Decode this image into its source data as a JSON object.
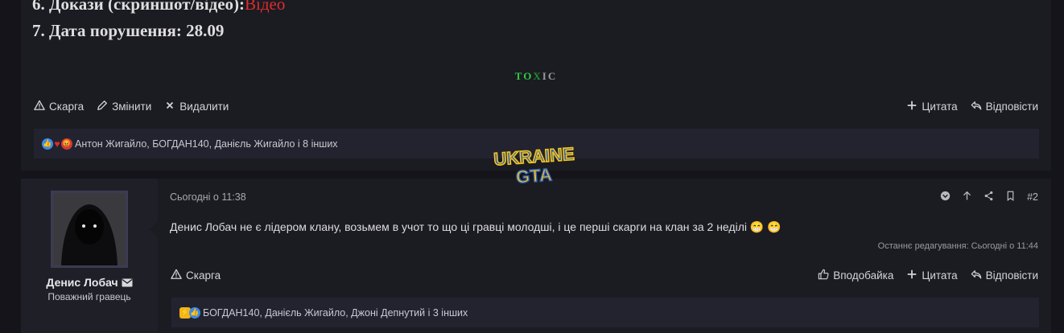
{
  "post1": {
    "line1_label": "6. Докази (скриншот/відео):",
    "line1_value": "Відео",
    "line2": "7. Дата порушення: 28.09",
    "signature": {
      "t": "T",
      "o": "O",
      "x": "X",
      "i": "I",
      "c": "C"
    },
    "actions": {
      "report": "Скарга",
      "edit": "Змінити",
      "delete": "Видалити",
      "quote": "Цитата",
      "reply": "Відповісти"
    },
    "reactions_text": "Антон Жигайло, БОГДАН140, Данієль Жигайло і 8 інших"
  },
  "watermark": {
    "line1": "UKRAINE",
    "line2": "GTA"
  },
  "post2": {
    "author": "Денис Лобач",
    "author_title": "Поважний гравець",
    "time": "Сьогодні о 11:38",
    "post_number": "#2",
    "message": "Денис Лобач не є лідером клану, возьмем в учот то що ці гравці молодші, і це перші скарги на клан за 2 неділі 😁 😁",
    "edited": "Останнє редагування: Сьогодні о 11:44",
    "actions": {
      "report": "Скарга",
      "like": "Вподобайка",
      "quote": "Цитата",
      "reply": "Відповісти"
    },
    "reactions_text": "БОГДАН140, Данієль Жигайло, Джоні Депнутий і 3 інших"
  },
  "colors": {
    "accent_red": "#e02c2c",
    "toxic_green": "#2ecc40",
    "toxic_grey": "#9a9a9a",
    "background": "#14141a",
    "panel": "#1b1b22"
  },
  "icons": [
    "warning-icon",
    "pencil-icon",
    "close-icon",
    "plus-icon",
    "reply-icon",
    "thumbs-up-icon",
    "heart-icon",
    "chevron-circle-down-icon",
    "arrow-up-icon",
    "share-icon",
    "bookmark-icon",
    "envelope-icon"
  ]
}
